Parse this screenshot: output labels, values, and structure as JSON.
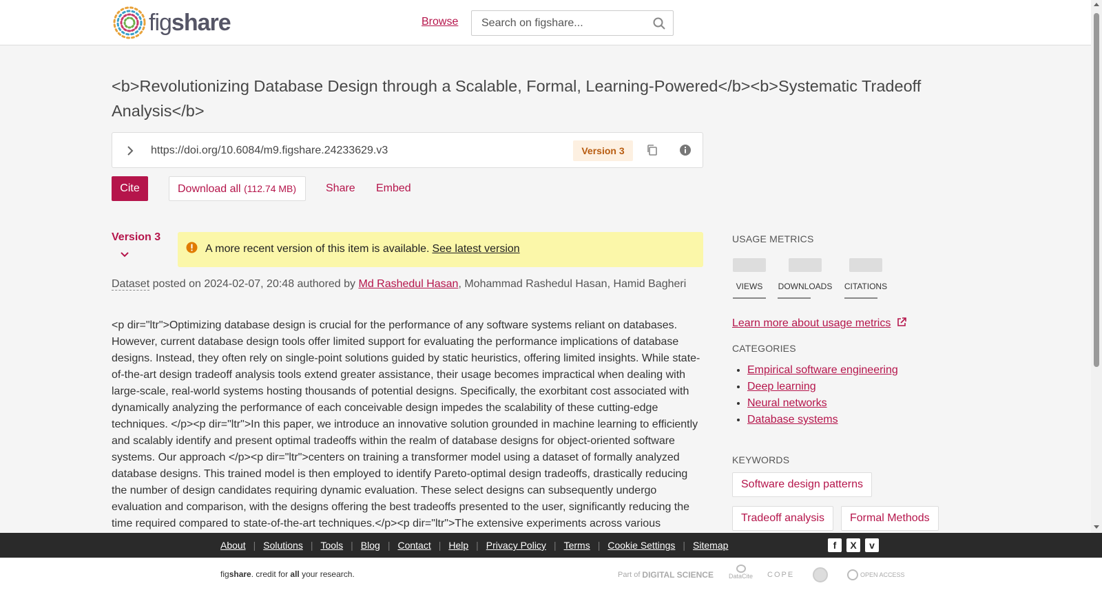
{
  "header": {
    "logo_text_light": "fig",
    "logo_text_bold": "share",
    "browse_label": "Browse",
    "search_placeholder": "Search on figshare..."
  },
  "item": {
    "title": "<b>Revolutionizing Database Design through a Scalable, Formal, Learning-Powered</b><b>Systematic Tradeoff Analysis</b>",
    "doi_url": "https://doi.org/10.6084/m9.figshare.24233629.v3",
    "version_badge": "Version 3",
    "version_select": "Version 3"
  },
  "actions": {
    "cite": "Cite",
    "download": "Download all",
    "download_size": "(112.74 MB)",
    "share": "Share",
    "embed": "Embed"
  },
  "notice": {
    "text": "A more recent version of this item is available.",
    "link": "See latest version"
  },
  "meta": {
    "type": "Dataset",
    "posted": " posted on 2024-02-07, 20:48 authored by ",
    "author_link": "Md Rashedul Hasan",
    "other_authors": ", Mohammad Rashedul Hasan, Hamid Bagheri"
  },
  "description": "<p dir=\"ltr\">Optimizing database design is crucial for the performance of any software systems reliant on databases. However, current database design tools offer limited support for evaluating the performance implications of database designs. Instead, they often rely on single-point solutions guided by static heuristics, offering limited insights. While state-of-the-art design tradeoff analysis tools extend greater assistance, their usage becomes impractical when dealing with large-scale, real-world systems hosting thousands of potential designs. Specifically, the exorbitant cost associated with dynamically analyzing the performance of each conceivable design impedes the scalability of these cutting-edge techniques. </p><p dir=\"ltr\">In this paper, we introduce an innovative solution grounded in machine learning to efficiently and scalably identify and present optimal tradeoffs within the realm of database designs for object-oriented software systems. Our approach </p><p dir=\"ltr\">centers on training a transformer model using a dataset of formally analyzed database designs. This trained model is then employed to identify Pareto-optimal design tradeoffs, drastically reducing the number of design candidates requiring dynamic evaluation. These select designs can subsequently undergo evaluation and comparison, with the designs offering the best tradeoffs presented to the user, significantly reducing the time required compared to state-of-the-art techniques.</p><p dir=\"ltr\">The extensive experiments across various",
  "sidebar": {
    "usage_heading": "USAGE METRICS",
    "metrics": [
      "VIEWS",
      "DOWNLOADS",
      "CITATIONS"
    ],
    "learn_more": "Learn more about usage metrics",
    "categories_heading": "CATEGORIES",
    "categories": [
      "Empirical software engineering",
      "Deep learning",
      "Neural networks",
      "Database systems"
    ],
    "keywords_heading": "KEYWORDS",
    "keywords": [
      "Software design patterns",
      "Tradeoff analysis",
      "Formal Methods"
    ]
  },
  "footer": {
    "links": [
      "About",
      "Solutions",
      "Tools",
      "Blog",
      "Contact",
      "Help",
      "Privacy Policy",
      "Terms",
      "Cookie Settings",
      "Sitemap"
    ],
    "tagline_prefix": "fig",
    "tagline_bold": "share",
    "tagline_mid": ". credit for ",
    "tagline_all": "all",
    "tagline_end": " your research.",
    "partner_part_of": "Part of",
    "partner_digital_science": "DIGITAL SCIENCE",
    "partner_datacite": "DataCite",
    "partner_cope": "COPE",
    "partner_open_access": "OPEN ACCESS"
  },
  "colors": {
    "brand": "#b5154b",
    "notice_bg": "#fbf7a9",
    "version_badge_bg": "#fdf0e1",
    "footer_bg": "#2a2a2a"
  }
}
